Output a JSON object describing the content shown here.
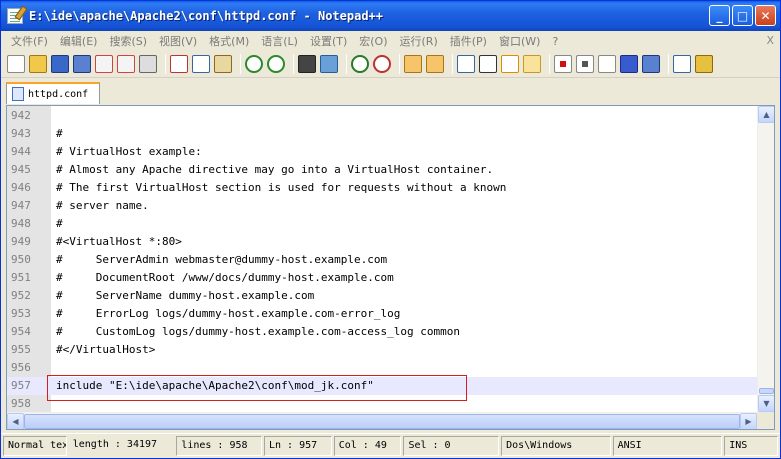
{
  "window": {
    "title": "E:\\ide\\apache\\Apache2\\conf\\httpd.conf - Notepad++",
    "minimize_glyph": "_",
    "maximize_glyph": "□",
    "close_glyph": "✕"
  },
  "menu": {
    "items": [
      "文件(F)",
      "编辑(E)",
      "搜索(S)",
      "视图(V)",
      "格式(M)",
      "语言(L)",
      "设置(T)",
      "宏(O)",
      "运行(R)",
      "插件(P)",
      "窗口(W)",
      "?"
    ],
    "close_label": "X"
  },
  "toolbar": {
    "icons": [
      "new-file-icon",
      "open-file-icon",
      "save-icon",
      "save-all-icon",
      "close-icon",
      "close-all-icon",
      "print-icon",
      "cut-icon",
      "copy-icon",
      "paste-icon",
      "undo-icon",
      "redo-icon",
      "find-icon",
      "replace-icon",
      "zoom-in-icon",
      "zoom-out-icon",
      "sync-v-icon",
      "sync-h-icon",
      "word-wrap-icon",
      "show-all-chars-icon",
      "indent-guide-icon",
      "user-lang-icon",
      "record-macro-icon",
      "stop-macro-icon",
      "play-macro-icon",
      "run-macro-multiple-icon",
      "save-macro-icon",
      "spell-check-icon",
      "plugin-icon"
    ]
  },
  "tab": {
    "label": "httpd.conf"
  },
  "editor": {
    "lines": [
      {
        "n": "942",
        "text": ""
      },
      {
        "n": "943",
        "text": "#"
      },
      {
        "n": "944",
        "text": "# VirtualHost example:"
      },
      {
        "n": "945",
        "text": "# Almost any Apache directive may go into a VirtualHost container."
      },
      {
        "n": "946",
        "text": "# The first VirtualHost section is used for requests without a known"
      },
      {
        "n": "947",
        "text": "# server name."
      },
      {
        "n": "948",
        "text": "#"
      },
      {
        "n": "949",
        "text": "#<VirtualHost *:80>"
      },
      {
        "n": "950",
        "text": "#     ServerAdmin webmaster@dummy-host.example.com"
      },
      {
        "n": "951",
        "text": "#     DocumentRoot /www/docs/dummy-host.example.com"
      },
      {
        "n": "952",
        "text": "#     ServerName dummy-host.example.com"
      },
      {
        "n": "953",
        "text": "#     ErrorLog logs/dummy-host.example.com-error_log"
      },
      {
        "n": "954",
        "text": "#     CustomLog logs/dummy-host.example.com-access_log common"
      },
      {
        "n": "955",
        "text": "#</VirtualHost>"
      },
      {
        "n": "956",
        "text": ""
      },
      {
        "n": "957",
        "text": "include \"E:\\ide\\apache\\Apache2\\conf\\mod_jk.conf\""
      },
      {
        "n": "958",
        "text": ""
      }
    ],
    "current_line_index": 15
  },
  "status": {
    "mode": "Normal tex",
    "length": "length : 34197",
    "lines": "lines : 958",
    "ln": "Ln : 957",
    "col": "Col : 49",
    "sel": "Sel : 0",
    "eol": "Dos\\Windows",
    "encoding": "ANSI",
    "ins": "INS"
  }
}
